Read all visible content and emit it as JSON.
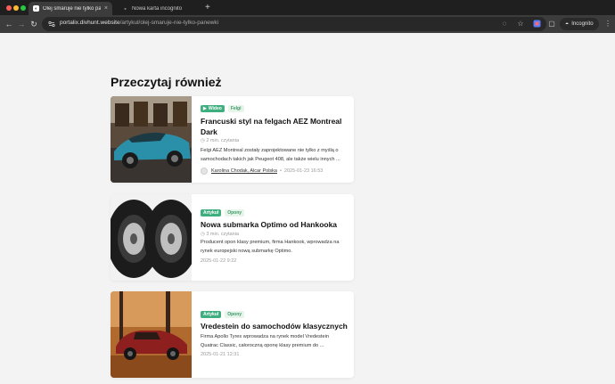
{
  "browser": {
    "tabs": [
      {
        "title": "Olej smaruje nie tylko panewki",
        "active": true
      },
      {
        "title": "Nowa karta incognito",
        "active": false
      }
    ],
    "new_tab_label": "+",
    "url_host": "portalix.divhunt.website",
    "url_path": "/artykul/olej-smaruje-nie-tylko-panewki",
    "incognito_label": "Incognito",
    "colors": {
      "tabstrip": "#1f1f1f",
      "toolbar": "#3c3c3c",
      "omnibox": "#282828"
    }
  },
  "page": {
    "section_title": "Przeczytaj również",
    "articles": [
      {
        "badges": [
          {
            "label": "Wideo",
            "style": "green",
            "icon": "play-icon"
          },
          {
            "label": "Felgi",
            "style": "light"
          }
        ],
        "title": "Francuski styl na felgach AEZ Montreal Dark",
        "read_time": "2 min. czytania",
        "excerpt": "Felgi AEZ Montreal zostały zaprojektowane nie tylko z myślą o samochodach takich jak Peugeot 408, ale także wielu innych ...",
        "author": "Karolina Chodak, Alcar Polska",
        "date": "2025-01-23 16:53"
      },
      {
        "badges": [
          {
            "label": "Artykuł",
            "style": "green"
          },
          {
            "label": "Opony",
            "style": "light"
          }
        ],
        "title": "Nowa submarka Optimo od Hankooka",
        "read_time": "3 min. czytania",
        "excerpt": "Producent opon klasy premium, firma Hankook, wprowadza na rynek europejski nową submarkę Optimo.",
        "date": "2025-01-22 9:22"
      },
      {
        "badges": [
          {
            "label": "Artykuł",
            "style": "green"
          },
          {
            "label": "Opony",
            "style": "light"
          }
        ],
        "title": "Vredestein do samochodów klasycznych",
        "excerpt": "Firma Apollo Tyres wprowadza na rynek model Vredestein Quatrac Classic, całoroczną oponę klasy premium do ...",
        "date": "2025-01-21 12:31"
      }
    ]
  }
}
